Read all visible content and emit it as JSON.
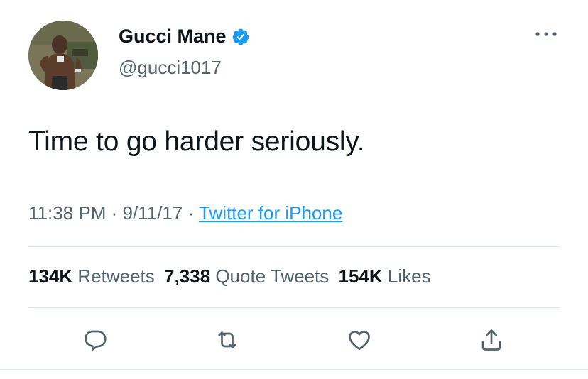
{
  "user": {
    "display_name": "Gucci Mane",
    "handle": "@gucci1017",
    "verified": true
  },
  "tweet": {
    "text": "Time to go harder seriously."
  },
  "meta": {
    "time": "11:38 PM",
    "separator": "·",
    "date": "9/11/17",
    "source": "Twitter for iPhone"
  },
  "stats": {
    "retweets_count": "134K",
    "retweets_label": "Retweets",
    "quotes_count": "7,338",
    "quotes_label": "Quote Tweets",
    "likes_count": "154K",
    "likes_label": "Likes"
  },
  "icons": {
    "more": "more-options-icon",
    "verified": "verified-badge-icon",
    "reply": "reply-icon",
    "retweet": "retweet-icon",
    "like": "heart-icon",
    "share": "share-icon"
  },
  "colors": {
    "accent": "#1d9bf0",
    "secondary_text": "#536471",
    "primary_text": "#0f1419"
  }
}
